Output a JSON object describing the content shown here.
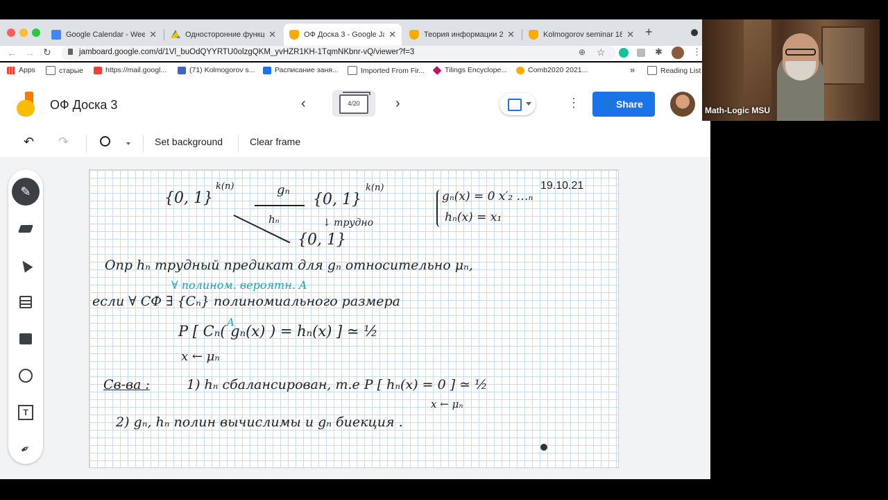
{
  "browser": {
    "tabs": [
      {
        "title": "Google Calendar - Week o",
        "color": "#4285f4"
      },
      {
        "title": "Односторонние функции",
        "color": "#34a853"
      },
      {
        "title": "ОФ Доска 3 - Google Jam",
        "color": "#f9ab00"
      },
      {
        "title": "Теория информации 202",
        "color": "#f9ab00"
      },
      {
        "title": "Kolmogorov seminar 18/1",
        "color": "#f9ab00"
      }
    ],
    "url": "jamboard.google.com/d/1Vl_buOdQYYRTU0olzgQKM_yvHZR1KH-1TqmNKbnr-vQ/viewer?f=3",
    "bookmarks": [
      {
        "label": "Apps",
        "color": "#e94235"
      },
      {
        "label": "старые",
        "color": "#5f6368"
      },
      {
        "label": "https://mail.googl...",
        "color": "#ea4335"
      },
      {
        "label": "(71) Kolmogorov s...",
        "color": "#4267b2"
      },
      {
        "label": "Расписание заня...",
        "color": "#1a73e8"
      },
      {
        "label": "Imported From Fir...",
        "color": "#5f6368"
      },
      {
        "label": "Tilings Encyclope...",
        "color": "#c2185b"
      },
      {
        "label": "Comb2020 2021...",
        "color": "#f9ab00"
      }
    ],
    "overflow": "»",
    "reading_list": "Reading List"
  },
  "app": {
    "title": "ОФ Доска 3",
    "frame_counter": "4/20",
    "share_label": "Share",
    "toolbar": {
      "set_background": "Set background",
      "clear_frame": "Clear frame"
    }
  },
  "board": {
    "date": "19.10.21",
    "lines": {
      "l1a": "{0, 1}",
      "l1b": "k(n)",
      "l1c": "gₙ",
      "l1d": "{0, 1}",
      "l1e": "k(n)",
      "l1f": "gₙ(x) = 0 x′₂ …ₙ",
      "l1g": "hₙ(x) = x₁",
      "l2a": "hₙ",
      "l2b": "↓ трудно",
      "l2c": "{0, 1}",
      "l3": "Опр   hₙ трудный предикат для gₙ относительно μₙ,",
      "l3blue": "∀ полином. вероятн. A",
      "l4": "если ∀ СФ ∃ {Cₙ} полиномиального размера",
      "l5": "P [ Cₙ( gₙ(x) ) = hₙ(x) ] ≃ ½",
      "l5a": "A",
      "l6": "x ← μₙ",
      "l7a": "Св-ва :",
      "l7b": "1) hₙ сбалансирован, т.е  P [ hₙ(x) = 0 ] ≃ ½",
      "l7c": "x ← μₙ",
      "l8": "2) gₙ, hₙ полин вычислимы и gₙ биекция ."
    }
  },
  "video": {
    "caption": "Math-Logic MSU"
  }
}
